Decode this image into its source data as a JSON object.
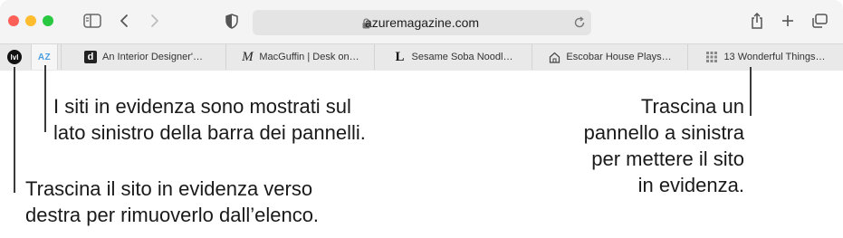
{
  "toolbar": {
    "url": "azuremagazine.com",
    "icons": [
      "sidebar-icon",
      "back-icon",
      "forward-icon",
      "privacy-shield-icon",
      "lock-icon",
      "reload-icon",
      "share-icon",
      "new-tab-icon",
      "tab-overview-icon"
    ]
  },
  "pinned_tabs": [
    {
      "label": "lvl"
    },
    {
      "label": "AZ"
    }
  ],
  "tabs": [
    {
      "favicon": "d",
      "title": "An Interior Designer'…"
    },
    {
      "favicon": "M",
      "title": "MacGuffin | Desk on…"
    },
    {
      "favicon": "L",
      "title": "Sesame Soba Noodl…"
    },
    {
      "favicon": "house-icon",
      "title": "Escobar House Plays…"
    },
    {
      "favicon": "grid-icon",
      "title": "13 Wonderful Things…"
    }
  ],
  "callouts": {
    "pinned_left_line1": "I siti in evidenza sono mostrati sul",
    "pinned_left_line2": "lato sinistro della barra dei pannelli.",
    "drag_right_line1": "Trascina il sito in evidenza verso",
    "drag_right_line2": "destra per rimuoverlo dall’elenco.",
    "drag_left_line1": "Trascina un",
    "drag_left_line2": "pannello a sinistra",
    "drag_left_line3": "per mettere il sito",
    "drag_left_line4": "in evidenza."
  },
  "colors": {
    "close": "#fe5f57",
    "minimize": "#febc2e",
    "zoom": "#28c840",
    "pinned_accent": "#4a9fe0"
  }
}
